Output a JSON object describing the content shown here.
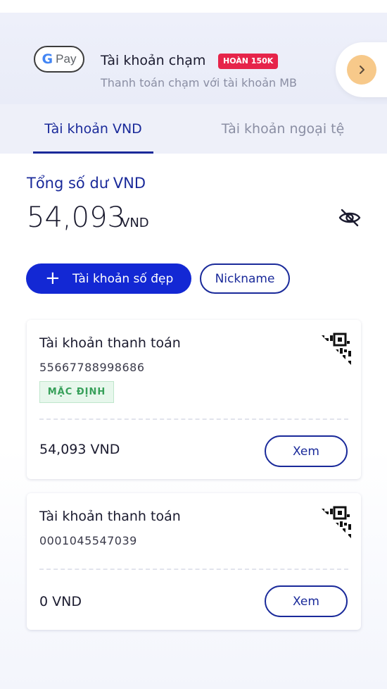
{
  "promo": {
    "gpay_g": "G",
    "gpay_label": "Pay",
    "title": "Tài khoản chạm",
    "badge": "HOÀN 150K",
    "subtitle": "Thanh toán chạm với tài khoản MB",
    "next_icon": "chevron-right-icon"
  },
  "tabs": [
    {
      "label": "Tài khoản VND",
      "active": true
    },
    {
      "label": "Tài khoản ngoại tệ",
      "active": false
    }
  ],
  "balance": {
    "title": "Tổng số dư VND",
    "amount": "54,093",
    "unit": "VND",
    "toggle_icon": "eye-off-icon"
  },
  "actions": {
    "primary_icon": "plus-icon",
    "primary_label": "Tài khoản số đẹp",
    "secondary_label": "Nickname"
  },
  "accounts": [
    {
      "title": "Tài khoản thanh toán",
      "number": "55667788998686",
      "badge": "MẶC ĐỊNH",
      "balance": "54,093 VND",
      "view_label": "Xem",
      "qr_icon": "qr-code-icon"
    },
    {
      "title": "Tài khoản thanh toán",
      "number": "0001045547039",
      "balance": "0 VND",
      "view_label": "Xem",
      "qr_icon": "qr-code-icon"
    }
  ],
  "colors": {
    "primary": "#1328d4",
    "accent_text": "#1a2a9a",
    "badge_red": "#e6244a",
    "badge_green": "#37a05a",
    "next_button": "#f7c98a"
  }
}
